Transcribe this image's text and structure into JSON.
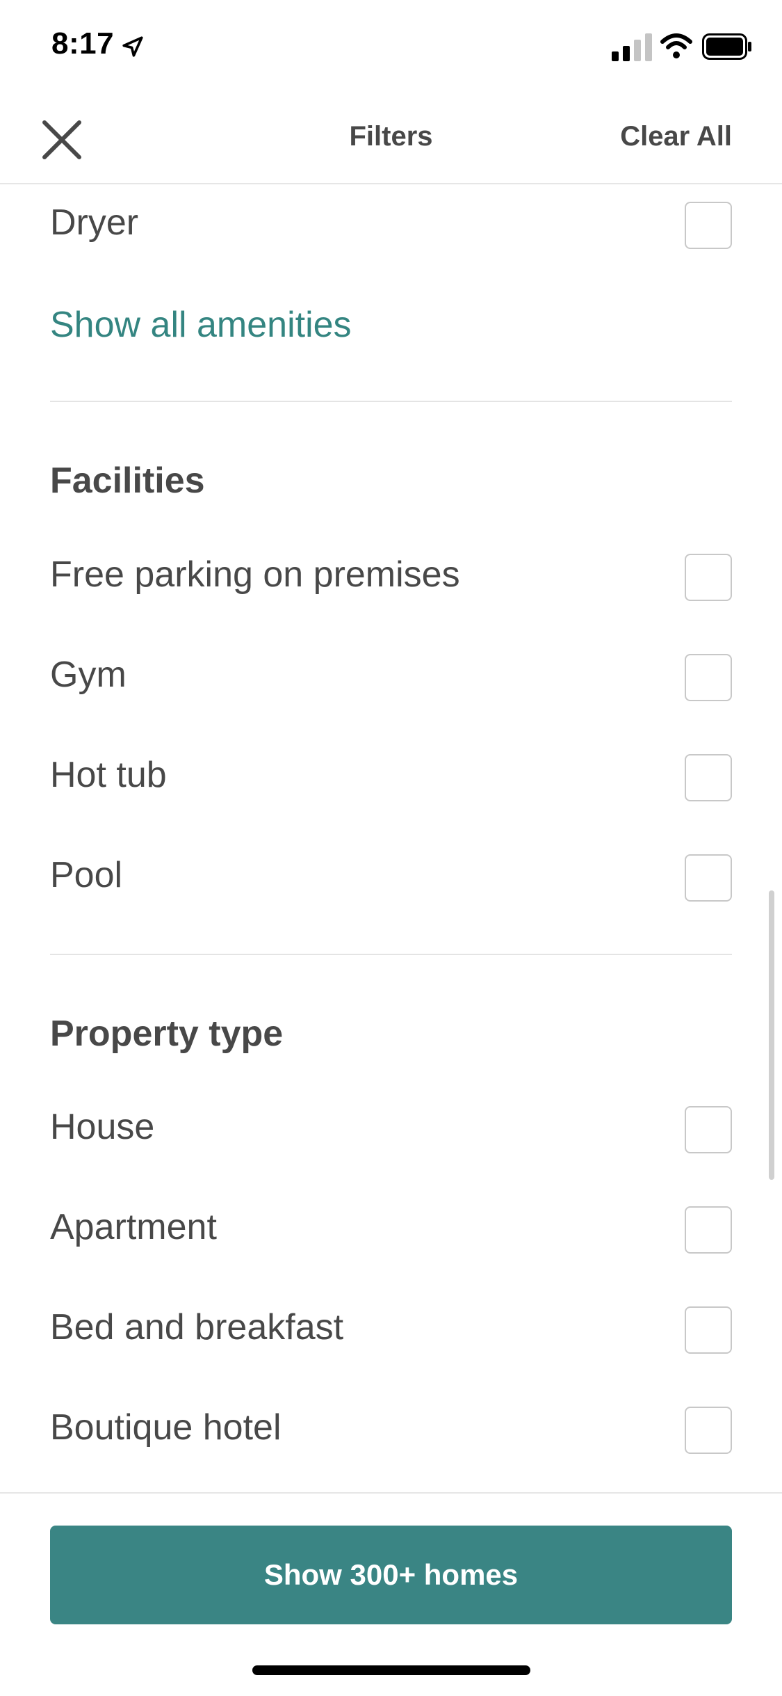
{
  "status_bar": {
    "time": "8:17"
  },
  "nav": {
    "title": "Filters",
    "clear_all": "Clear All"
  },
  "amenities": {
    "last_item": "Dryer",
    "show_all": "Show all amenities"
  },
  "facilities": {
    "title": "Facilities",
    "items": [
      "Free parking on premises",
      "Gym",
      "Hot tub",
      "Pool"
    ]
  },
  "property_type": {
    "title": "Property type",
    "items": [
      "House",
      "Apartment",
      "Bed and breakfast",
      "Boutique hotel"
    ]
  },
  "footer": {
    "cta_label": "Show 300+ homes"
  },
  "colors": {
    "accent": "#3a8584",
    "link": "#348581",
    "text": "#484848"
  },
  "icons": [
    "close-icon",
    "location-arrow-icon",
    "signal-icon",
    "wifi-icon",
    "battery-icon"
  ]
}
